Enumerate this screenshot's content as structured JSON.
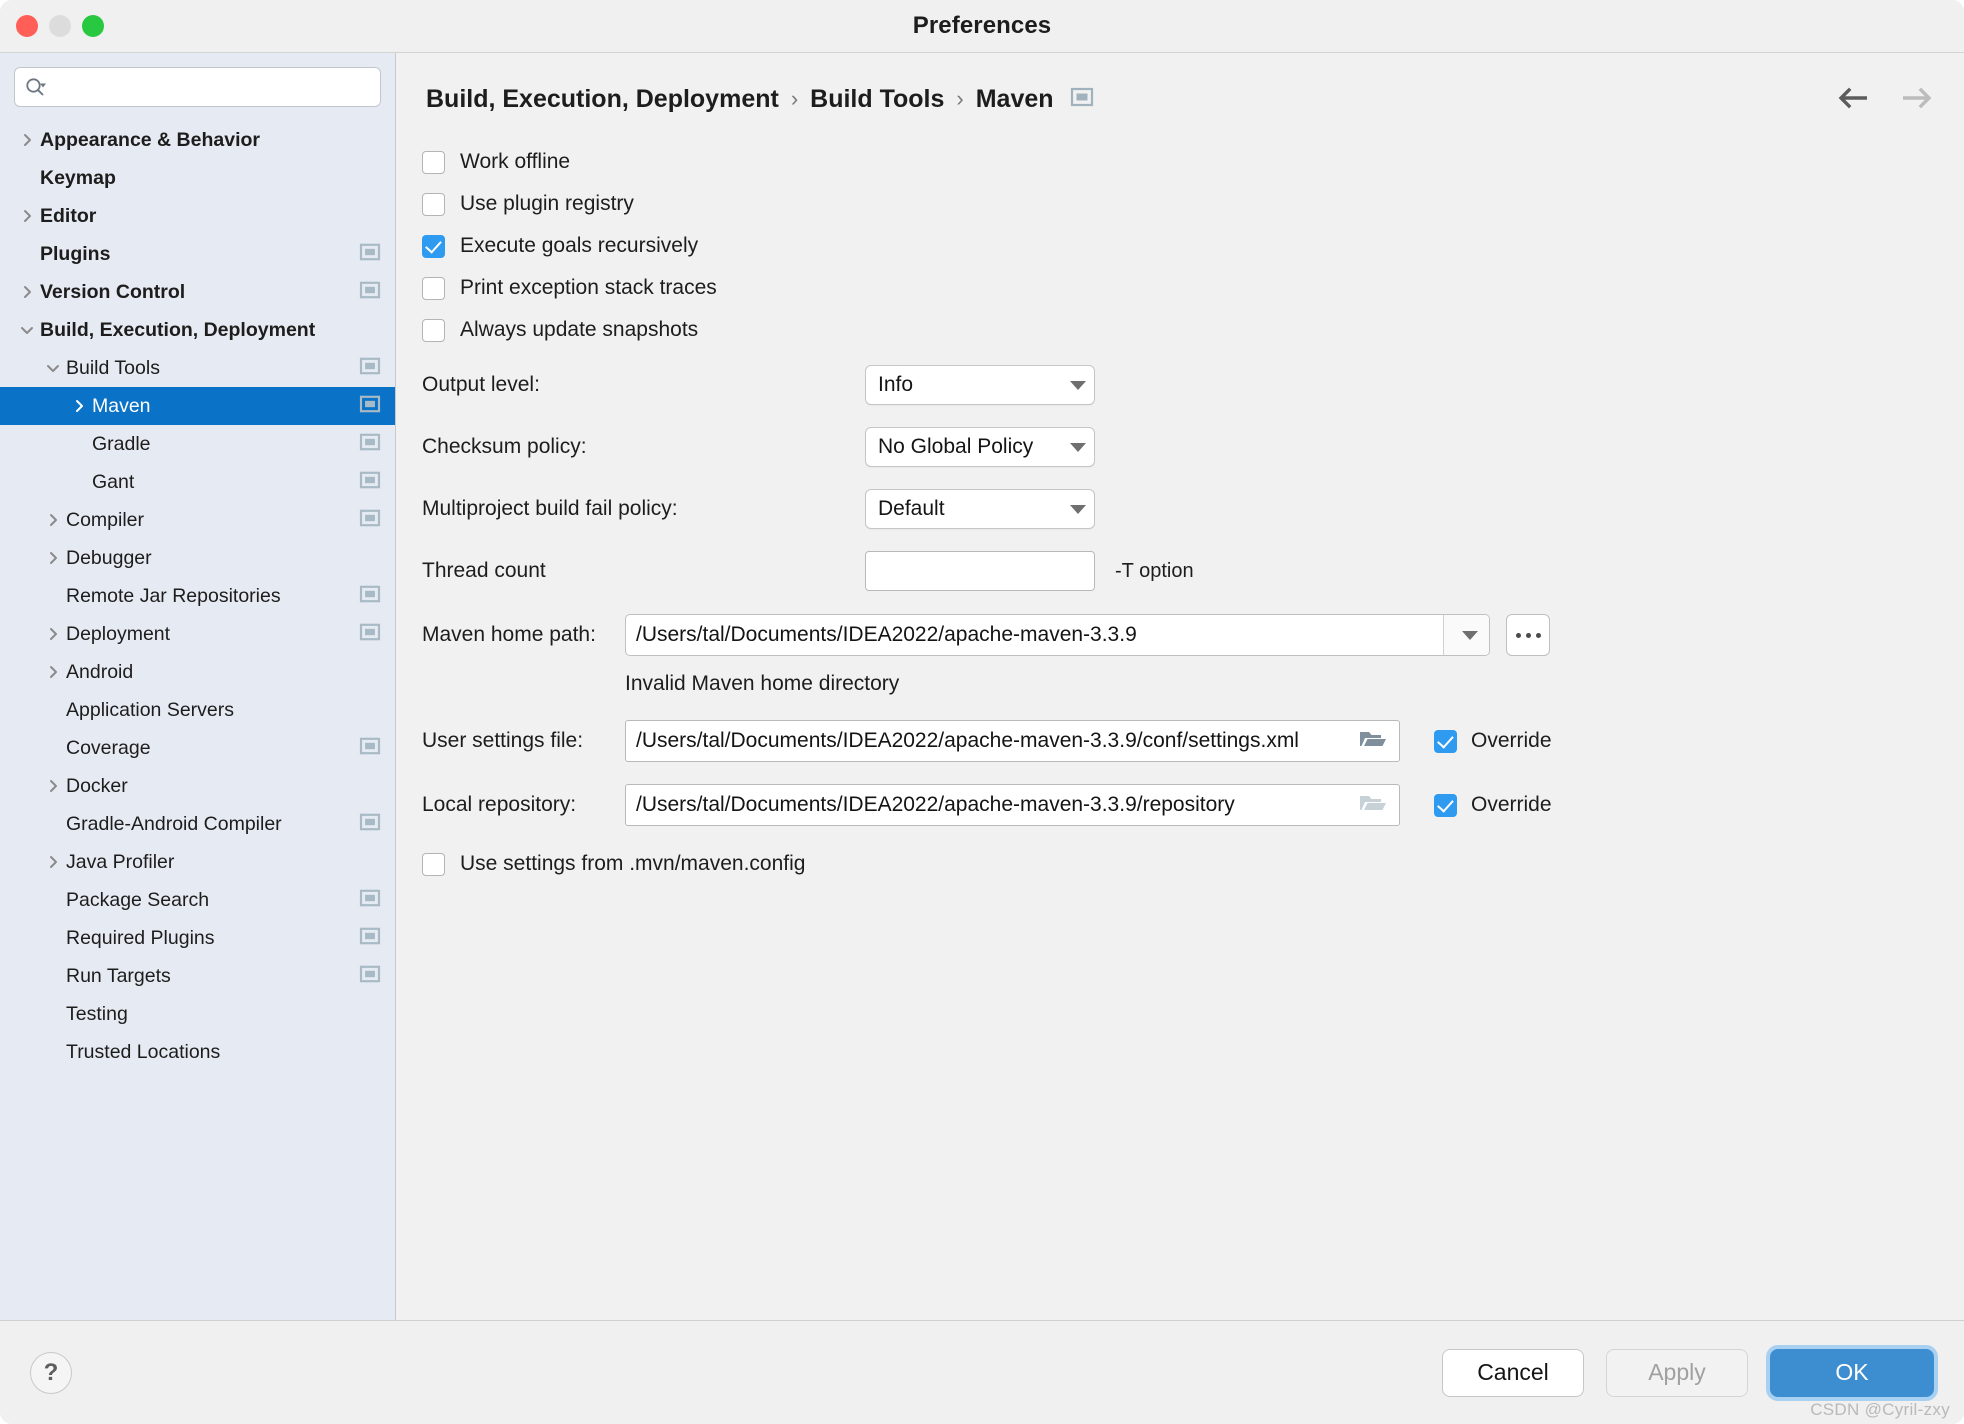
{
  "window": {
    "title": "Preferences",
    "traffic_lights": [
      "close-red",
      "minimize-yellow",
      "zoom-green"
    ]
  },
  "search": {
    "value": "",
    "placeholder": "",
    "icon": "search-icon"
  },
  "sidebar": {
    "items": [
      {
        "label": "Appearance & Behavior",
        "indent": 0,
        "arrow": "right",
        "bold": true,
        "panel_icon": false,
        "selected": false
      },
      {
        "label": "Keymap",
        "indent": 0,
        "arrow": "none",
        "bold": true,
        "panel_icon": false,
        "selected": false
      },
      {
        "label": "Editor",
        "indent": 0,
        "arrow": "right",
        "bold": true,
        "panel_icon": false,
        "selected": false
      },
      {
        "label": "Plugins",
        "indent": 0,
        "arrow": "none",
        "bold": true,
        "panel_icon": true,
        "selected": false
      },
      {
        "label": "Version Control",
        "indent": 0,
        "arrow": "right",
        "bold": true,
        "panel_icon": true,
        "selected": false
      },
      {
        "label": "Build, Execution, Deployment",
        "indent": 0,
        "arrow": "down",
        "bold": true,
        "panel_icon": false,
        "selected": false
      },
      {
        "label": "Build Tools",
        "indent": 1,
        "arrow": "down",
        "bold": false,
        "panel_icon": true,
        "selected": false
      },
      {
        "label": "Maven",
        "indent": 2,
        "arrow": "right",
        "bold": false,
        "panel_icon": true,
        "selected": true
      },
      {
        "label": "Gradle",
        "indent": 2,
        "arrow": "none",
        "bold": false,
        "panel_icon": true,
        "selected": false
      },
      {
        "label": "Gant",
        "indent": 2,
        "arrow": "none",
        "bold": false,
        "panel_icon": true,
        "selected": false
      },
      {
        "label": "Compiler",
        "indent": 1,
        "arrow": "right",
        "bold": false,
        "panel_icon": true,
        "selected": false
      },
      {
        "label": "Debugger",
        "indent": 1,
        "arrow": "right",
        "bold": false,
        "panel_icon": false,
        "selected": false
      },
      {
        "label": "Remote Jar Repositories",
        "indent": 1,
        "arrow": "none",
        "bold": false,
        "panel_icon": true,
        "selected": false
      },
      {
        "label": "Deployment",
        "indent": 1,
        "arrow": "right",
        "bold": false,
        "panel_icon": true,
        "selected": false
      },
      {
        "label": "Android",
        "indent": 1,
        "arrow": "right",
        "bold": false,
        "panel_icon": false,
        "selected": false
      },
      {
        "label": "Application Servers",
        "indent": 1,
        "arrow": "none",
        "bold": false,
        "panel_icon": false,
        "selected": false
      },
      {
        "label": "Coverage",
        "indent": 1,
        "arrow": "none",
        "bold": false,
        "panel_icon": true,
        "selected": false
      },
      {
        "label": "Docker",
        "indent": 1,
        "arrow": "right",
        "bold": false,
        "panel_icon": false,
        "selected": false
      },
      {
        "label": "Gradle-Android Compiler",
        "indent": 1,
        "arrow": "none",
        "bold": false,
        "panel_icon": true,
        "selected": false
      },
      {
        "label": "Java Profiler",
        "indent": 1,
        "arrow": "right",
        "bold": false,
        "panel_icon": false,
        "selected": false
      },
      {
        "label": "Package Search",
        "indent": 1,
        "arrow": "none",
        "bold": false,
        "panel_icon": true,
        "selected": false
      },
      {
        "label": "Required Plugins",
        "indent": 1,
        "arrow": "none",
        "bold": false,
        "panel_icon": true,
        "selected": false
      },
      {
        "label": "Run Targets",
        "indent": 1,
        "arrow": "none",
        "bold": false,
        "panel_icon": true,
        "selected": false
      },
      {
        "label": "Testing",
        "indent": 1,
        "arrow": "none",
        "bold": false,
        "panel_icon": false,
        "selected": false
      },
      {
        "label": "Trusted Locations",
        "indent": 1,
        "arrow": "none",
        "bold": false,
        "panel_icon": false,
        "selected": false
      }
    ]
  },
  "breadcrumb": {
    "parts": [
      "Build, Execution, Deployment",
      "Build Tools",
      "Maven"
    ],
    "separator": "›",
    "panel_icon": "project-settings-icon",
    "back_icon": "arrow-left-icon",
    "forward_icon": "arrow-right-icon"
  },
  "main": {
    "checkboxes": [
      {
        "label": "Work offline",
        "checked": false
      },
      {
        "label": "Use plugin registry",
        "checked": false
      },
      {
        "label": "Execute goals recursively",
        "checked": true
      },
      {
        "label": "Print exception stack traces",
        "checked": false
      },
      {
        "label": "Always update snapshots",
        "checked": false
      }
    ],
    "selects": [
      {
        "label": "Output level:",
        "value": "Info"
      },
      {
        "label": "Checksum policy:",
        "value": "No Global Policy"
      },
      {
        "label": "Multiproject build fail policy:",
        "value": "Default"
      }
    ],
    "thread_count": {
      "label": "Thread count",
      "value": "",
      "hint": "-T option"
    },
    "maven_home": {
      "label": "Maven home path:",
      "value": "/Users/tal/Documents/IDEA2022/apache-maven-3.3.9",
      "browse_label": "...",
      "error": "Invalid Maven home directory"
    },
    "user_settings": {
      "label": "User settings file:",
      "value": "/Users/tal/Documents/IDEA2022/apache-maven-3.3.9/conf/settings.xml",
      "folder_icon": "folder-open-icon",
      "override_label": "Override",
      "override_checked": true
    },
    "local_repository": {
      "label": "Local repository:",
      "value": "/Users/tal/Documents/IDEA2022/apache-maven-3.3.9/repository",
      "folder_icon": "folder-open-icon",
      "override_label": "Override",
      "override_checked": true
    },
    "mvn_config": {
      "label": "Use settings from .mvn/maven.config",
      "checked": false
    }
  },
  "footer": {
    "help_label": "?",
    "cancel_label": "Cancel",
    "apply_label": "Apply",
    "ok_label": "OK"
  },
  "watermark": "CSDN @Cyril-zxy",
  "colors": {
    "selection_blue": "#0a73c7",
    "checkbox_blue": "#2e9bf0",
    "ok_button_blue": "#3d8ed1",
    "sidebar_bg": "#e6eaf2",
    "main_bg": "#f1f1f1"
  }
}
